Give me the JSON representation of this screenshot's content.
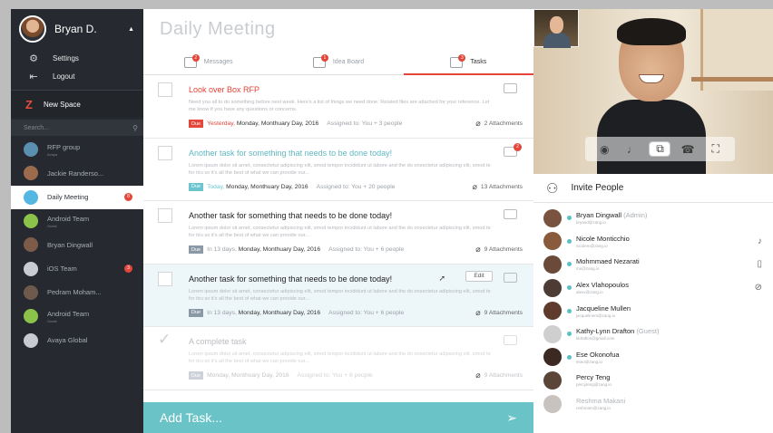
{
  "sidebar": {
    "user_name": "Bryan D.",
    "settings_label": "Settings",
    "logout_label": "Logout",
    "new_space_label": "New Space",
    "search_placeholder": "Search...",
    "spaces": [
      {
        "name": "RFP group",
        "sub": "Avaya",
        "color": "#5b8fb0",
        "badge": ""
      },
      {
        "name": "Jackie Randerso...",
        "sub": "",
        "color": "#9c6a4d",
        "badge": ""
      },
      {
        "name": "Daily Meeting",
        "sub": "",
        "color": "#54b7e2",
        "badge": "8"
      },
      {
        "name": "Android Team",
        "sub": "Guest",
        "color": "#8bc34a",
        "badge": ""
      },
      {
        "name": "Bryan Dingwall",
        "sub": "",
        "color": "#7c5b49",
        "badge": ""
      },
      {
        "name": "iOS Team",
        "sub": "",
        "color": "#9aa0a6",
        "badge": "3"
      },
      {
        "name": "Pedram Moham...",
        "sub": "",
        "color": "#6e5a4c",
        "badge": ""
      },
      {
        "name": "Android Team",
        "sub": "Guest",
        "color": "#8bc34a",
        "badge": ""
      },
      {
        "name": "Avaya Global",
        "sub": "",
        "color": "#9aa0a6",
        "badge": ""
      }
    ]
  },
  "main": {
    "title": "Daily Meeting",
    "tabs": [
      {
        "label": "Messages",
        "badge": "2"
      },
      {
        "label": "Idea Board",
        "badge": "1"
      },
      {
        "label": "Tasks",
        "badge": "3"
      }
    ],
    "tasks": [
      {
        "title": "Look over Box RFP",
        "desc": "Need you all to do something before next week. Here's a list of things we need done. Related files are attached for your reference. Let me know if you have any questions or concerns.",
        "due_label": "Due",
        "due_prefix": "Yesterday,",
        "due_date": "Monday, Monthuary Day, 2016",
        "assigned": "Assigned to: You + 3 people",
        "attachments": "2 Attachments",
        "comment_badge": ""
      },
      {
        "title": "Another task for something that needs to be done today!",
        "desc": "Lorem ipsum dolor sit amet, consectetur adipiscing elit, smod tempor incididunt ut labore and the do onsectetur adipiscing elit, smod te for itru so it's all the best of what we can provide our...",
        "due_label": "Due",
        "due_prefix": "Today,",
        "due_date": "Monday, Monthuary Day, 2016",
        "assigned": "Assigned to: You + 20 people",
        "attachments": "13 Attachments",
        "comment_badge": "2"
      },
      {
        "title": "Another task for something that needs to be done today!",
        "desc": "Lorem ipsum dolor sit amet, consectetur adipiscing elit, smod tempor incididunt ut labore and the do onsectetur adipiscing elit, smod te for itru so it's all the best of what we can provide our...",
        "due_label": "Due",
        "due_prefix": "In 13 days,",
        "due_date": "Monday, Monthuary Day, 2016",
        "assigned": "Assigned to: You + 6 people",
        "attachments": "9 Attachments",
        "comment_badge": ""
      },
      {
        "title": "Another task for something that needs to be done today!",
        "desc": "Lorem ipsum dolor sit amet, consectetur adipiscing elit, smod tempor incididunt ut labore and the do onsectetur adipiscing elit, smod te for itru so it's all the best of what we can provide our...",
        "due_label": "Due",
        "due_prefix": "In 13 days,",
        "due_date": "Monday, Monthuary Day, 2016",
        "assigned": "Assigned to: You + 6 people",
        "attachments": "9 Attachments",
        "edit_label": "Edit",
        "comment_badge": ""
      },
      {
        "title": "A complete task",
        "desc": "Lorem ipsum dolor sit amet, consectetur adipiscing elit, smod tempor incididunt ut labore and the do onsectetur adipiscing elit, smod te for itru so it's all the best of what we can provide our...",
        "due_label": "Due",
        "due_prefix": "",
        "due_date": "Monday, Monthuary Day, 2016",
        "assigned": "Assigned to: You + 6 people",
        "attachments": "9 Attachments",
        "comment_badge": ""
      }
    ],
    "add_task_placeholder": "Add Task..."
  },
  "right": {
    "invite_label": "Invite People",
    "people": [
      {
        "name": "Bryan Dingwall",
        "role": "(Admin)",
        "email": "bryand@zang.io",
        "online": true,
        "color": "#7a5240"
      },
      {
        "name": "Nicole Monticchio",
        "role": "",
        "email": "nicolem@zang.io",
        "online": true,
        "color": "#8a5a3d"
      },
      {
        "name": "Mohmmaed Nezarati",
        "role": "",
        "email": "mo@zang.io",
        "online": true,
        "color": "#6b4a3a"
      },
      {
        "name": "Alex Vlahopoulos",
        "role": "",
        "email": "alexv@zang.io",
        "online": true,
        "color": "#4d3c33"
      },
      {
        "name": "Jacqueline Mullen",
        "role": "",
        "email": "jacquelinem@zang.io",
        "online": true,
        "color": "#5e3b2c"
      },
      {
        "name": "Kathy-Lynn Drafton",
        "role": "(Guest)",
        "email": "kldrafton@gmail.com",
        "online": true,
        "color": "#cfcfcf"
      },
      {
        "name": "Ese Okonofua",
        "role": "",
        "email": "eseo@zang.io",
        "online": true,
        "color": "#3c2a22"
      },
      {
        "name": "Percy Teng",
        "role": "",
        "email": "percyteng@zang.io",
        "online": false,
        "color": "#5a4538"
      },
      {
        "name": "Reshma Makani",
        "role": "",
        "email": "reshmam@zang.io",
        "online": false,
        "color": "#c9c3bf"
      }
    ]
  }
}
